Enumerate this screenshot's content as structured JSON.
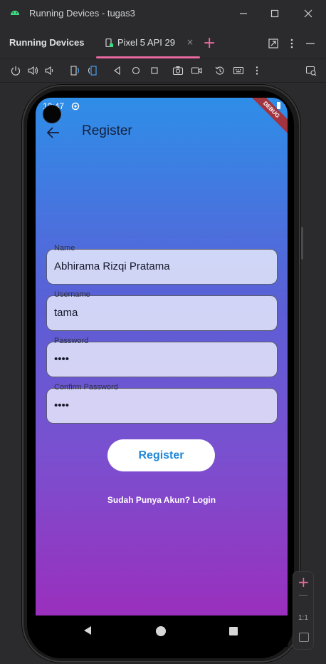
{
  "window": {
    "title": "Running Devices - tugas3",
    "minimize_icon": "minimize-icon",
    "maximize_icon": "maximize-icon",
    "close_icon": "close-icon"
  },
  "tool_window": {
    "heading": "Running Devices",
    "tab": {
      "label": "Pixel 5 API 29",
      "close": "×"
    },
    "add_tab": "+",
    "accent": "#e86aa0"
  },
  "toolbar": {
    "icons": [
      "power-icon",
      "volume-up-icon",
      "volume-down-icon",
      "rotate-left-icon",
      "rotate-right-icon",
      "back-icon",
      "home-icon",
      "overview-icon",
      "screenshot-icon",
      "screen-record-icon",
      "reset-icon",
      "keyboard-icon",
      "more-icon",
      "extended-controls-icon"
    ]
  },
  "device": {
    "status": {
      "time": "10:47",
      "ribbon": "DEBUG"
    },
    "app": {
      "title": "Register",
      "fields": [
        {
          "label": "Name",
          "value": "Abhirama Rizqi Pratama"
        },
        {
          "label": "Username",
          "value": "tama"
        },
        {
          "label": "Password",
          "value": "••••"
        },
        {
          "label": "Confirm Password",
          "value": "••••"
        }
      ],
      "register_button": "Register",
      "login_link": "Sudah Punya Akun? Login"
    }
  },
  "side_controls": {
    "plus": "+",
    "ratio": "1:1"
  },
  "colors": {
    "brand_button_text": "#2187d8",
    "gradient_top": "#2e8ee8",
    "gradient_bottom": "#9a2fbd"
  }
}
